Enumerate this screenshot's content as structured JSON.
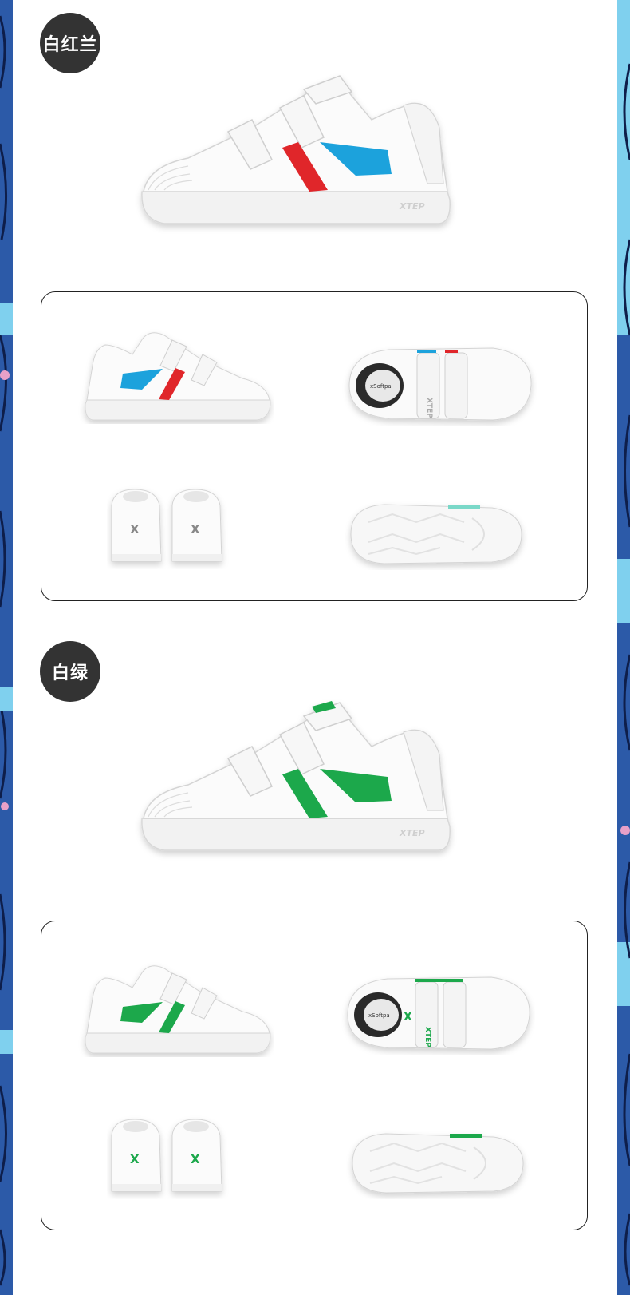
{
  "colors": {
    "border_blue": "#2c5aa8",
    "border_light": "#7fd0ee",
    "badge_bg": "#333333",
    "red": "#e0262c",
    "blue": "#1aa2dc",
    "green": "#1aa84c"
  },
  "sections": [
    {
      "badge_label": "白红兰",
      "stripe_front": "red",
      "stripe_back": "blue",
      "hero_brand": "XTEP",
      "views": [
        "side-view",
        "top-view",
        "back-view",
        "sole-view"
      ],
      "top_view_insole": "xSoftpa",
      "top_view_strap": "XTEP"
    },
    {
      "badge_label": "白绿",
      "stripe_front": "green",
      "stripe_back": "green",
      "hero_brand": "XTEP",
      "views": [
        "side-view",
        "top-view",
        "back-view",
        "sole-view"
      ],
      "top_view_insole": "xSoftpa",
      "top_view_strap": "XTEP"
    }
  ]
}
